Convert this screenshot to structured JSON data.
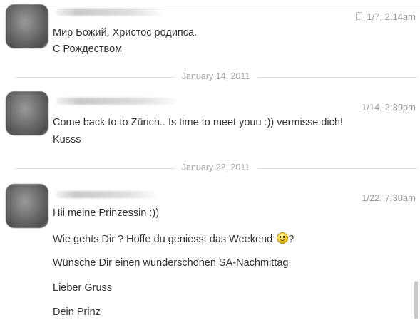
{
  "messages": [
    {
      "time": "1/7, 2:14am",
      "lines": [
        "Мир Божий, Христос родипса.",
        "С Рождеством"
      ]
    },
    {
      "time": "1/14, 2:39pm",
      "lines": [
        "Come back to to Zürich.. Is time to meet youu :)) vermisse dich!",
        "Kusss"
      ]
    },
    {
      "time": "1/22, 7:30am",
      "lines": [
        "Hii meine Prinzessin :))",
        "Wie gehts Dir ? Hoffe du geniesst das Weekend",
        "?",
        "Wünsche Dir einen wunderschönen SA-Nachmittag",
        "Lieber Gruss",
        "Dein Prinz"
      ]
    }
  ],
  "dividers": [
    "January 14, 2011",
    "January 22, 2011"
  ],
  "icons": {
    "mobile": "mobile-phone-icon",
    "smiley": "smiley-emoticon-icon"
  }
}
